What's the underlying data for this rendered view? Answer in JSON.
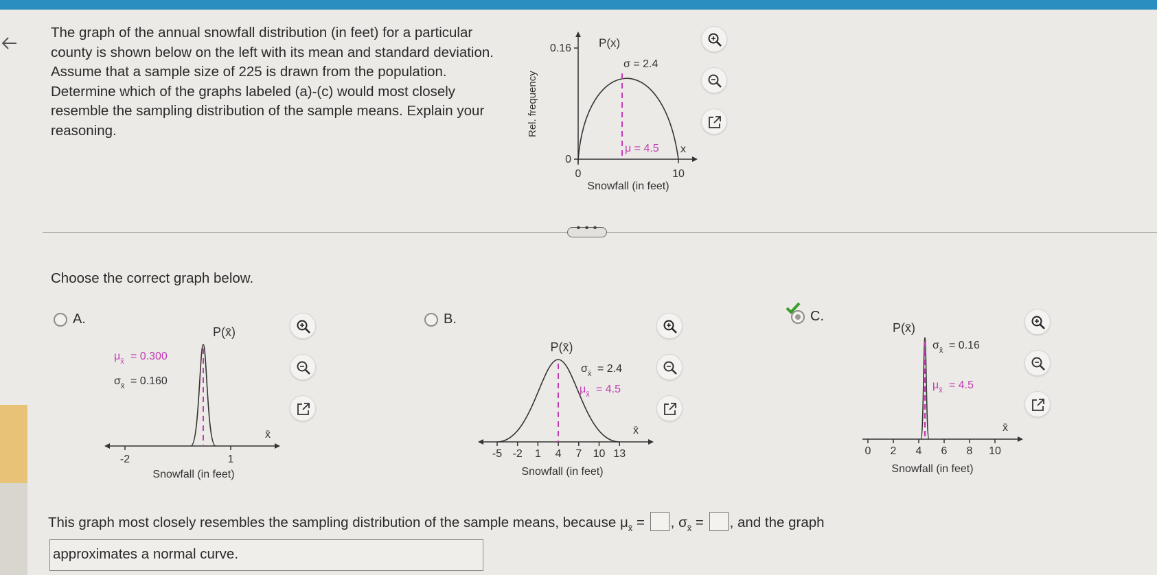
{
  "question": {
    "text": "The graph of the annual snowfall distribution (in feet) for a particular county is shown below on the left with its mean and standard deviation. Assume that a sample size of 225 is drawn from the population. Determine which of the graphs labeled (a)-(c) would most closely resemble the sampling distribution of the sample means. Explain your reasoning."
  },
  "population_graph": {
    "y_top_tick": "0.16",
    "y_zero_tick": "0",
    "ylabel": "Rel. frequency",
    "title": "P(x)",
    "sigma_label": "σ = 2.4",
    "mu_label": "μ = 4.5",
    "x_axis_var": "x",
    "x_tick_left": "0",
    "x_tick_right": "10",
    "xlabel": "Snowfall (in feet)"
  },
  "prompt": "Choose the correct graph below.",
  "options": {
    "a": {
      "label": "A.",
      "title": "P(x̄)",
      "mu_text": "= 0.300",
      "sigma_text": "= 0.160",
      "tick_left": "-2",
      "tick_right": "1",
      "x_var": "x̄",
      "xlabel": "Snowfall (in feet)"
    },
    "b": {
      "label": "B.",
      "title": "P(x̄)",
      "sigma_text": "= 2.4",
      "mu_text": "= 4.5",
      "ticks": [
        "-5",
        "-2",
        "1",
        "4",
        "7",
        "10",
        "13"
      ],
      "x_var": "x̄",
      "xlabel": "Snowfall (in feet)"
    },
    "c": {
      "label": "C.",
      "title": "P(x̄)",
      "sigma_text": "= 0.16",
      "mu_text": "= 4.5",
      "ticks": [
        "0",
        "2",
        "4",
        "6",
        "8",
        "10"
      ],
      "x_var": "x̄",
      "xlabel": "Snowfall (in feet)"
    },
    "selected": "c"
  },
  "answer": {
    "prefix": "This graph most closely resembles the sampling distribution of the sample means, because",
    "mu_symbol": "μ",
    "sigma_symbol": "σ",
    "equals": "=",
    "sep": ",",
    "suffix": ", and the graph",
    "dropdown_value": "approximates a normal curve."
  },
  "colors": {
    "accent_bar": "#2a8fc0",
    "mean_line": "#c23bb4",
    "curve": "#333333"
  }
}
